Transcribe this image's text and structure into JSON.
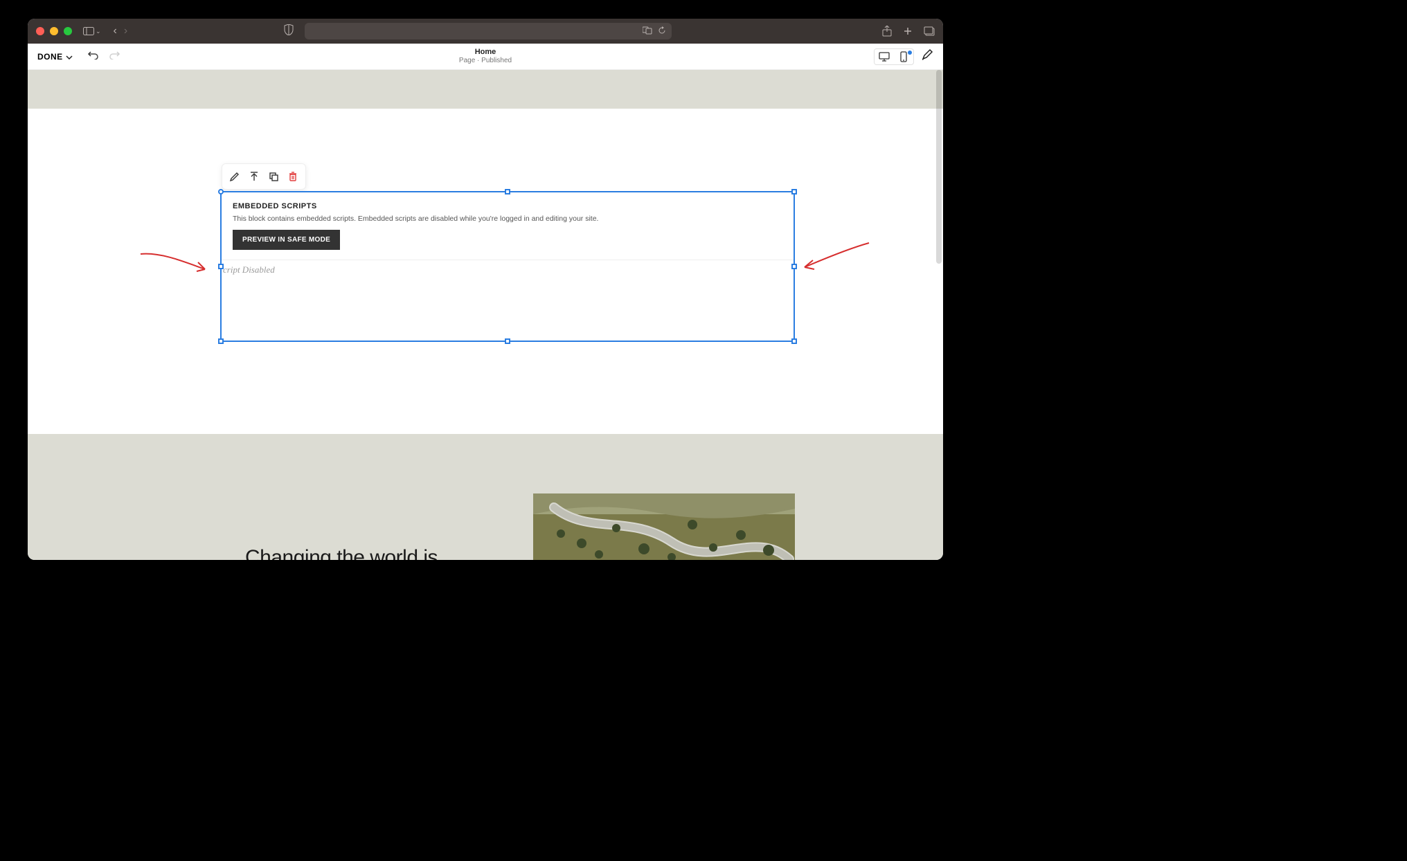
{
  "toolbar": {
    "done_label": "DONE"
  },
  "header": {
    "page_title": "Home",
    "page_status": "Page · Published"
  },
  "block_toolbar": {
    "icons": [
      "pencil",
      "move-up",
      "duplicate",
      "trash"
    ]
  },
  "embed": {
    "title": "EMBEDDED SCRIPTS",
    "description": "This block contains embedded scripts. Embedded scripts are disabled while you're logged in and editing your site.",
    "button_label": "PREVIEW IN SAFE MODE",
    "disabled_text": "cript Disabled"
  },
  "lower": {
    "heading": "Changing the world is"
  },
  "colors": {
    "selection": "#2a7de1",
    "annotation": "#d62e2e",
    "canvas_bg": "#dcdcd3"
  }
}
